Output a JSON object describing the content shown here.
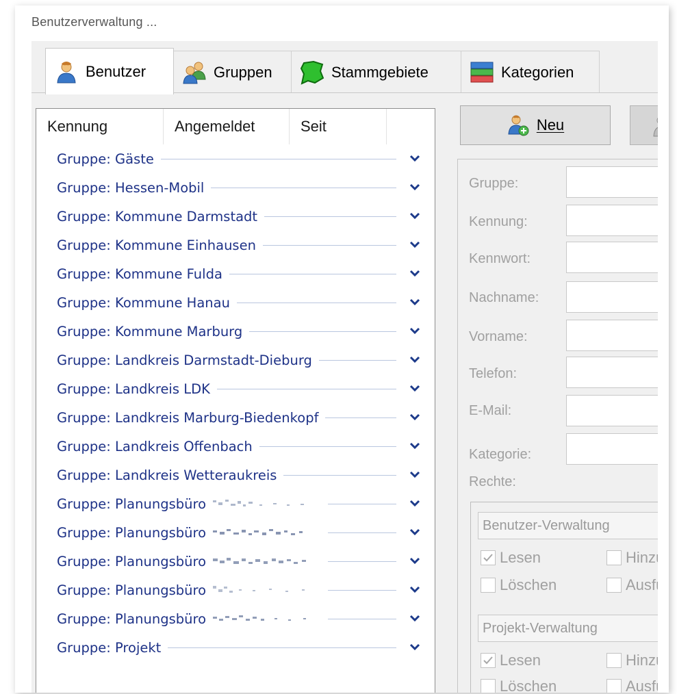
{
  "window": {
    "title": "Benutzerverwaltung ..."
  },
  "tabs": [
    {
      "label": "Benutzer",
      "icon": "user-icon",
      "active": true
    },
    {
      "label": "Gruppen",
      "icon": "group-icon",
      "active": false
    },
    {
      "label": "Stammgebiete",
      "icon": "map-area-icon",
      "active": false
    },
    {
      "label": "Kategorien",
      "icon": "categories-icon",
      "active": false
    }
  ],
  "list": {
    "columns": [
      "Kennung",
      "Angemeldet",
      "Seit"
    ],
    "groups": [
      "Gruppe: Gäste",
      "Gruppe: Hessen-Mobil",
      "Gruppe: Kommune Darmstadt",
      "Gruppe: Kommune Einhausen",
      "Gruppe: Kommune Fulda",
      "Gruppe: Kommune Hanau",
      "Gruppe: Kommune Marburg",
      "Gruppe: Landkreis Darmstadt-Dieburg",
      "Gruppe: Landkreis LDK",
      "Gruppe: Landkreis Marburg-Biedenkopf",
      "Gruppe: Landkreis Offenbach",
      "Gruppe: Landkreis Wetteraukreis",
      "Gruppe: Planungsbüro",
      "Gruppe: Planungsbüro",
      "Gruppe: Planungsbüro",
      "Gruppe: Planungsbüro",
      "Gruppe: Planungsbüro",
      "Gruppe: Projekt"
    ]
  },
  "actions": {
    "new_label": "Neu"
  },
  "form": {
    "labels": [
      "Gruppe:",
      "Kennung:",
      "Kennwort:",
      "Nachname:",
      "Vorname:",
      "Telefon:",
      "E-Mail:",
      "Kategorie:"
    ],
    "rights_label": "Rechte:"
  },
  "rights": {
    "benutzer": {
      "title": "Benutzer-Verwaltung",
      "lesen": "Lesen",
      "hinzu": "Hinzu",
      "loeschen": "Löschen",
      "ausfu": "Ausfü"
    },
    "projekt": {
      "title": "Projekt-Verwaltung",
      "lesen": "Lesen",
      "hinzu": "Hinzu",
      "loeschen": "Löschen",
      "ausfu": "Ausfü"
    }
  },
  "colors": {
    "group_text": "#1e3287",
    "group_line": "#b9c6df",
    "chevron": "#1c3a8a",
    "disabled_text": "#a0a0a0"
  }
}
